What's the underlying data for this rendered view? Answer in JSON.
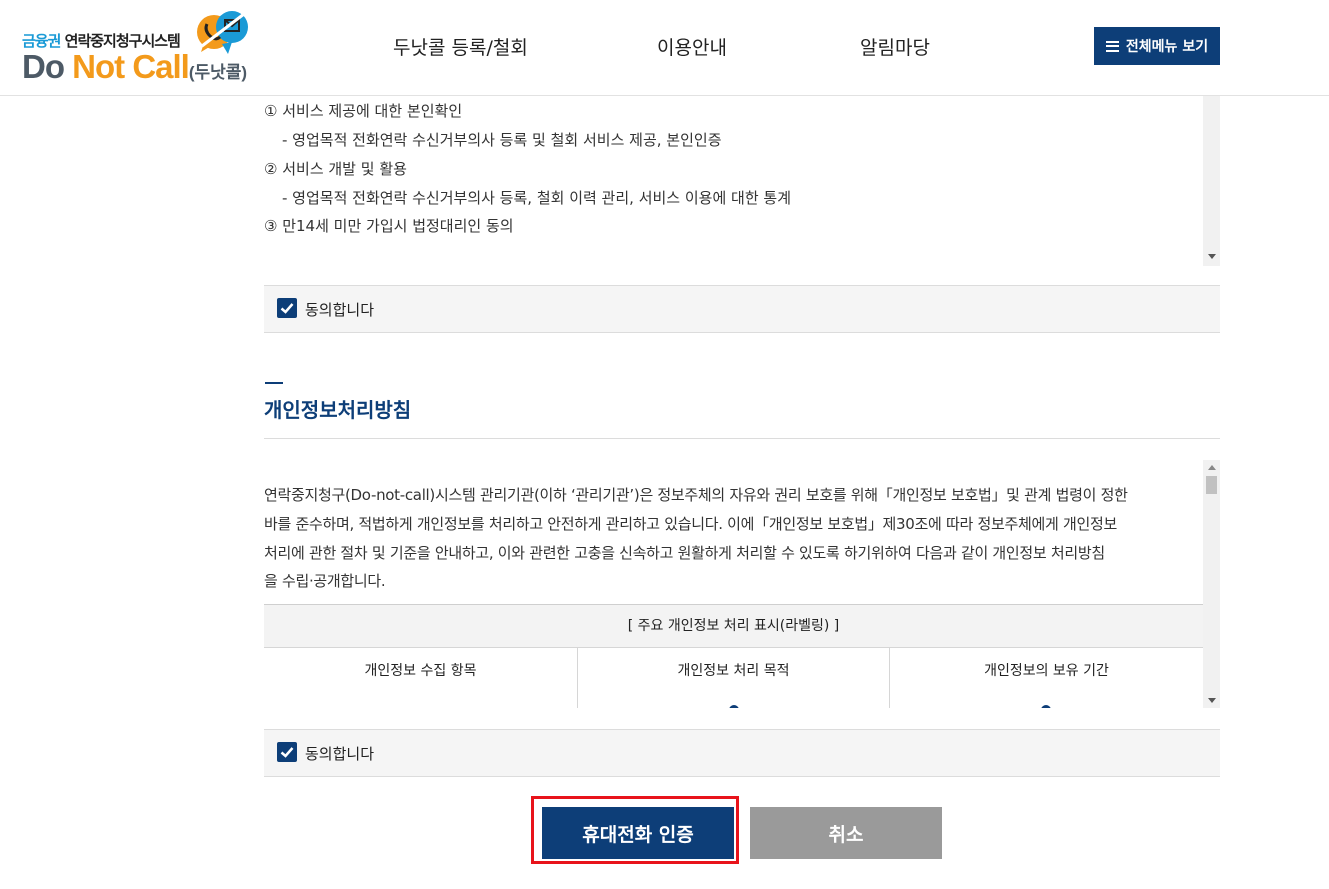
{
  "header": {
    "logo": {
      "subtitle_prefix": "금융권",
      "subtitle_rest": "연락중지청구시스템",
      "title_do": "Do",
      "title_not_call": "Not Call",
      "title_paren": "(두낫콜)"
    },
    "nav": [
      "두낫콜 등록/철회",
      "이용안내",
      "알림마당"
    ],
    "menu_button": "전체메뉴 보기"
  },
  "terms_box": {
    "lines": [
      "① 서비스 제공에 대한 본인확인",
      "- 영업목적 전화연락 수신거부의사 등록 및 철회 서비스 제공, 본인인증",
      "② 서비스 개발 및 활용",
      "- 영업목적 전화연락 수신거부의사 등록, 철회 이력 관리, 서비스 이용에 대한 통계",
      "③ 만14세 미만 가입시 법정대리인 동의"
    ]
  },
  "agree1": {
    "label": "동의합니다",
    "checked": true
  },
  "privacy_section": {
    "title": "개인정보처리방침",
    "paragraph_lines": [
      "연락중지청구(Do-not-call)시스템 관리기관(이하 ‘관리기관’)은   정보주체의 자유와 권리 보호를 위해「개인정보 보호법」및 관계 법령이 정한",
      "바를 준수하며, 적법하게 개인정보를 처리하고 안전하게 관리하고 있습니다. 이에「개인정보 보호법」제30조에 따라 정보주체에게 개인정보",
      "처리에 관한 절차 및 기준을 안내하고, 이와 관련한 고충을 신속하고 원활하게 처리할 수 있도록 하기위하여 다음과 같이 개인정보 처리방침",
      "을 수립·공개합니다."
    ],
    "table_title": "[ 주요 개인정보 처리 표시(라벨링) ]",
    "table_columns": [
      "개인정보 수집 항목",
      "개인정보 처리 목적",
      "개인정보의 보유 기간"
    ]
  },
  "agree2": {
    "label": "동의합니다",
    "checked": true
  },
  "buttons": {
    "verify": "휴대전화 인증",
    "cancel": "취소"
  },
  "colors": {
    "primary": "#0d3e78",
    "accent_orange": "#f39a1b",
    "highlight_red": "#e8131b",
    "cancel_gray": "#9a9a9a"
  }
}
